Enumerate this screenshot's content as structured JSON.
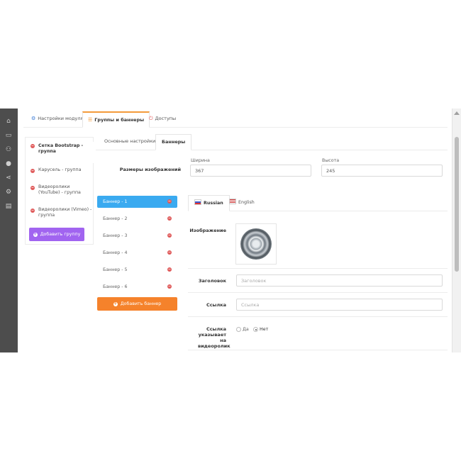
{
  "top_tabs": [
    {
      "label": "Настройки модуля",
      "icon": "gear-icon"
    },
    {
      "label": "Группы и баннеры",
      "icon": "list-icon"
    },
    {
      "label": "Доступы",
      "icon": "power-icon"
    }
  ],
  "sidebar_icons": [
    "home-icon",
    "monitor-icon",
    "cart-icon",
    "user-icon",
    "share-icon",
    "gear-icon",
    "bar-chart-icon"
  ],
  "groups": [
    {
      "label": "Сетка Bootstrap - группа"
    },
    {
      "label": "Карусель - группа"
    },
    {
      "label": "Видеоролики (YouTube) - группа"
    },
    {
      "label": "Видеоролики (Vimeo) - группа"
    }
  ],
  "add_group_label": "Добавить группу",
  "inner_tabs": [
    {
      "label": "Основные настройки"
    },
    {
      "label": "Баннеры"
    }
  ],
  "image_size": {
    "label": "Размеры изображений",
    "width_label": "Ширина",
    "width_value": "367",
    "height_label": "Высота",
    "height_value": "245"
  },
  "banners": [
    "Баннер - 1",
    "Баннер - 2",
    "Баннер - 3",
    "Баннер - 4",
    "Баннер - 5",
    "Баннер - 6"
  ],
  "add_banner_label": "Добавить баннер",
  "lang_tabs": [
    {
      "label": "Russian"
    },
    {
      "label": "English"
    }
  ],
  "form": {
    "image_label": "Изображение",
    "title_label": "Заголовок",
    "title_placeholder": "Заголовок",
    "link_label": "Ссылка",
    "link_placeholder": "Ссылка",
    "video_link_label": "Ссылка указывает на видеоролик",
    "yes_label": "Да",
    "no_label": "Нет",
    "video_link_value": "Нет"
  },
  "colors": {
    "sidebar": "#4d4d4d",
    "active_banner": "#3aaaf0",
    "add_group": "#a164f0",
    "add_banner": "#f5822b",
    "tab_accent": "#f49b3a",
    "delete_dot": "#e05b5b"
  }
}
